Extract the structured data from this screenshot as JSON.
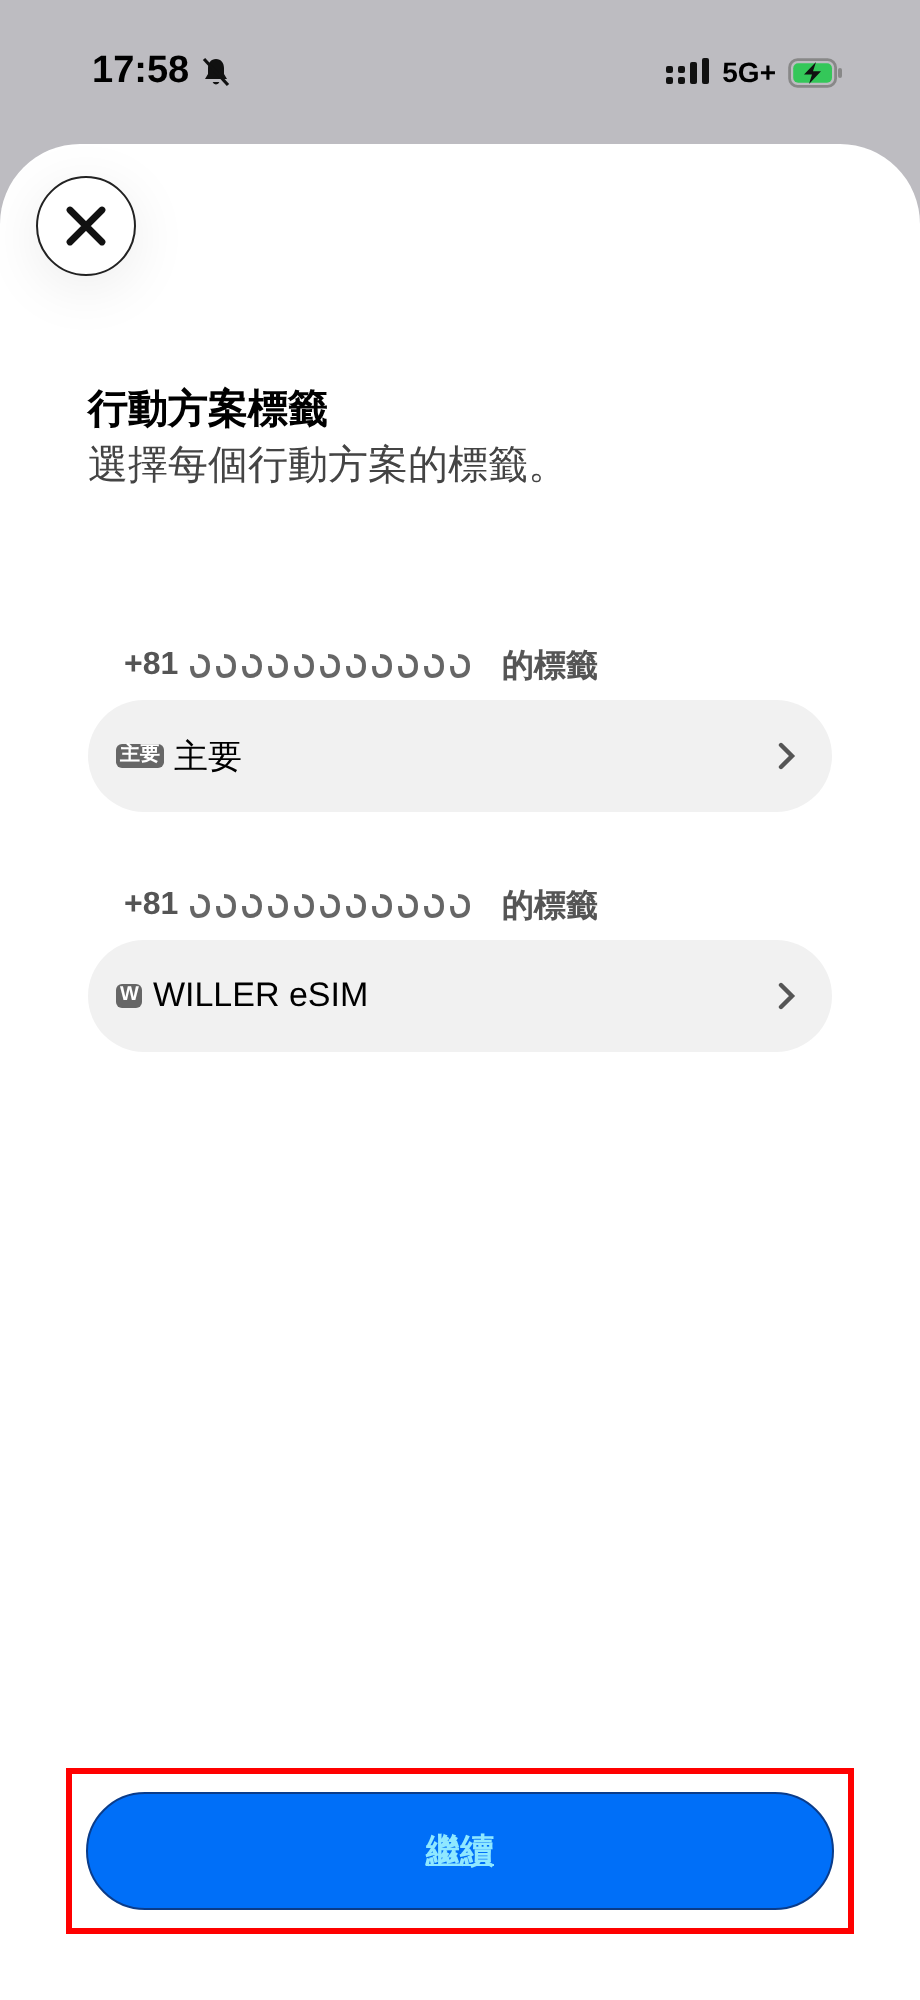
{
  "status_bar": {
    "time": "17:58",
    "network": "5G+"
  },
  "sheet": {
    "title": "行動方案標籤",
    "subtitle": "選擇每個行動方案的標籤。"
  },
  "lines": [
    {
      "prefix": "+81",
      "suffix": "的標籤",
      "badge": "主要",
      "label": "主要"
    },
    {
      "prefix": "+81",
      "suffix": "的標籤",
      "badge": "W",
      "label": "WILLER eSIM"
    }
  ],
  "continue_button": {
    "label": "繼續",
    "highlighted": true
  }
}
